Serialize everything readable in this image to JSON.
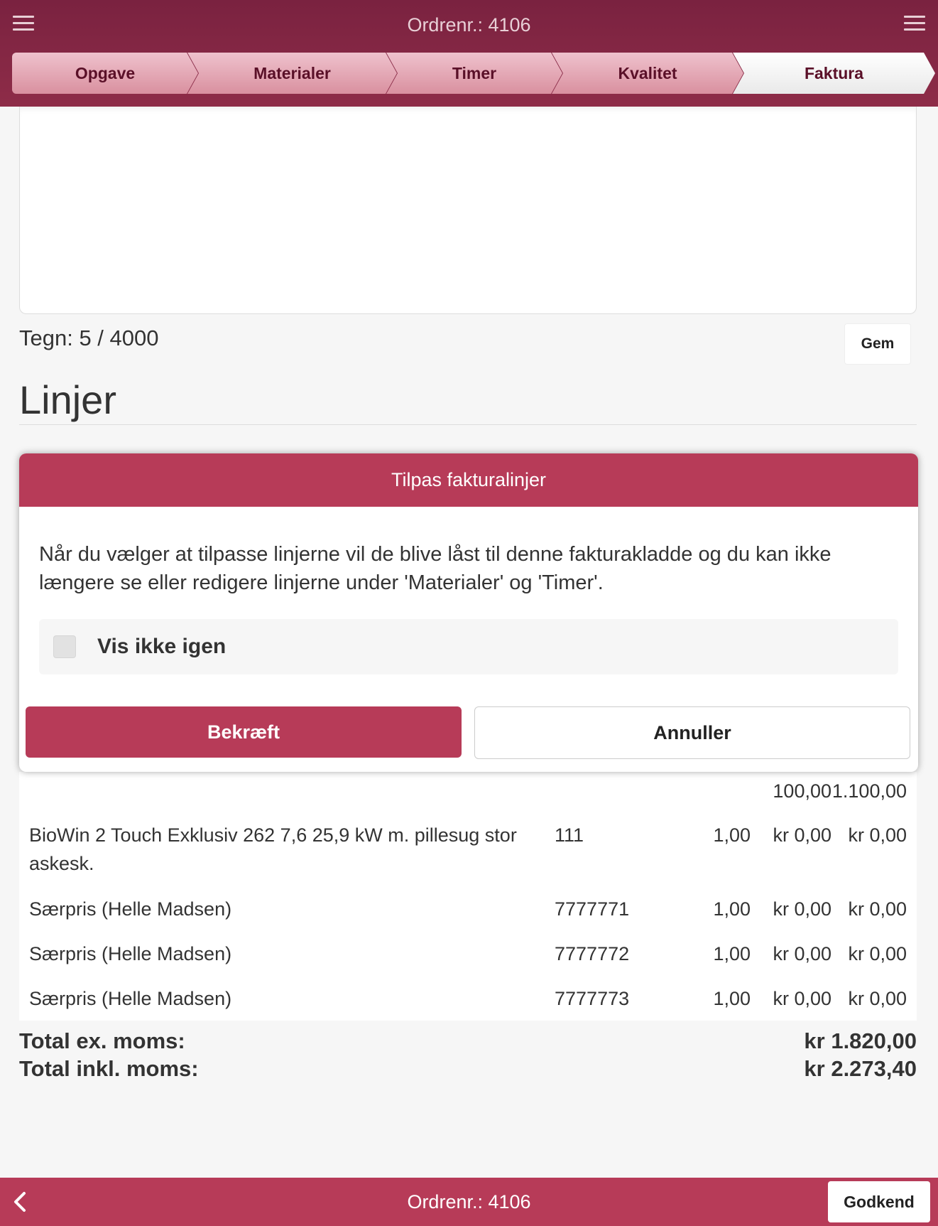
{
  "header": {
    "title": "Ordrenr.: 4106"
  },
  "steps": [
    {
      "label": "Opgave"
    },
    {
      "label": "Materialer"
    },
    {
      "label": "Timer"
    },
    {
      "label": "Kvalitet"
    },
    {
      "label": "Faktura"
    }
  ],
  "notes": {
    "char_count": "Tegn: 5 / 4000",
    "save_label": "Gem"
  },
  "section_title": "Linjer",
  "dialog": {
    "title": "Tilpas fakturalinjer",
    "message": "Når du vælger at tilpasse linjerne vil de blive låst til denne fakturakladde og du kan ikke længere se eller redigere linjerne under 'Materialer' og 'Timer'.",
    "checkbox_label": "Vis ikke igen",
    "checkbox_checked": false,
    "confirm_label": "Bekræft",
    "cancel_label": "Annuller"
  },
  "lines": {
    "partial_row": {
      "price": "100,00",
      "total": "1.100,00"
    },
    "rows": [
      {
        "description": "BioWin 2 Touch Exklusiv 262 7,6  25,9 kW m. pillesug stor askesk.",
        "number": "111",
        "qty": "1,00",
        "price": "kr 0,00",
        "total": "kr 0,00"
      },
      {
        "description": "Særpris (Helle Madsen)",
        "number": "7777771",
        "qty": "1,00",
        "price": "kr 0,00",
        "total": "kr 0,00"
      },
      {
        "description": "Særpris (Helle Madsen)",
        "number": "7777772",
        "qty": "1,00",
        "price": "kr 0,00",
        "total": "kr 0,00"
      },
      {
        "description": "Særpris (Helle Madsen)",
        "number": "7777773",
        "qty": "1,00",
        "price": "kr 0,00",
        "total": "kr 0,00"
      }
    ]
  },
  "totals": {
    "ex_label": "Total ex. moms:",
    "ex_value": "kr 1.820,00",
    "incl_label": "Total inkl. moms:",
    "incl_value": "kr 2.273,40"
  },
  "footer": {
    "title": "Ordrenr.: 4106",
    "approve_label": "Godkend"
  },
  "colors": {
    "header": "#8e2c48",
    "accent": "#b73b58"
  }
}
